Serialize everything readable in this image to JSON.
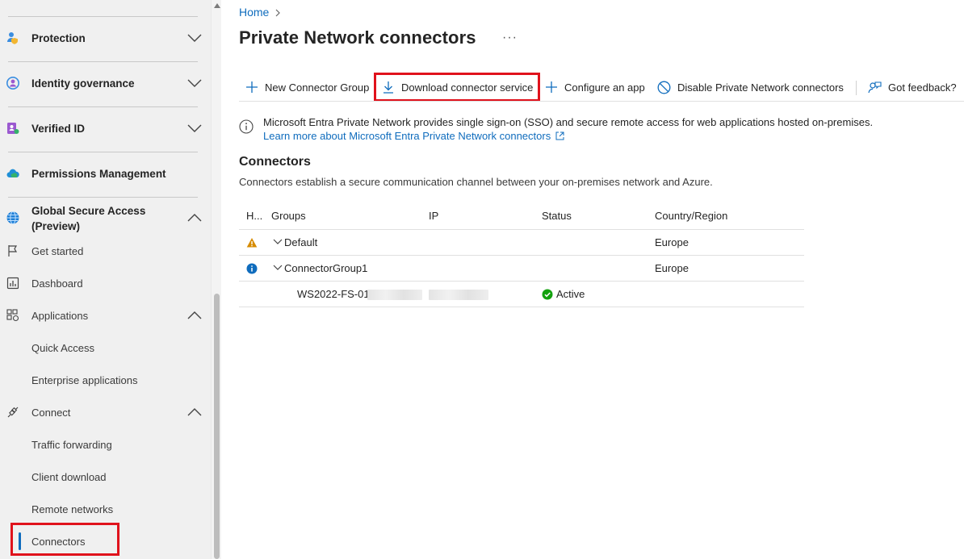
{
  "sidebar": {
    "sections": [
      {
        "label": "Protection",
        "icon": "protection-icon"
      },
      {
        "label": "Identity governance",
        "icon": "identity-governance-icon"
      },
      {
        "label": "Verified ID",
        "icon": "verified-id-icon"
      },
      {
        "label": "Permissions Management",
        "icon": "cloud-icon"
      },
      {
        "label": "Global Secure Access",
        "label2": "(Preview)",
        "icon": "globe-icon"
      }
    ],
    "items": {
      "get_started": "Get started",
      "dashboard": "Dashboard",
      "applications": "Applications",
      "quick_access": "Quick Access",
      "enterprise_applications": "Enterprise applications",
      "connect": "Connect",
      "traffic_forwarding": "Traffic forwarding",
      "client_download": "Client download",
      "remote_networks": "Remote networks",
      "connectors": "Connectors"
    },
    "active_item": "Connectors"
  },
  "breadcrumb": {
    "home": "Home"
  },
  "page": {
    "title": "Private Network connectors",
    "more": "···"
  },
  "toolbar": {
    "new_group": "New Connector Group",
    "download": "Download connector service",
    "configure": "Configure an app",
    "disable": "Disable Private Network connectors",
    "feedback": "Got feedback?"
  },
  "info": {
    "text": "Microsoft Entra Private Network provides single sign-on (SSO) and secure remote access for web applications hosted on-premises.",
    "link": "Learn more about Microsoft Entra Private Network connectors"
  },
  "connectors": {
    "heading": "Connectors",
    "description": "Connectors establish a secure communication channel between your on-premises network and Azure.",
    "columns": {
      "health": "H...",
      "groups": "Groups",
      "ip": "IP",
      "status": "Status",
      "region": "Country/Region"
    },
    "rows": [
      {
        "group": "Default",
        "region": "Europe",
        "health": "warning"
      },
      {
        "group": "ConnectorGroup1",
        "region": "Europe",
        "health": "info"
      },
      {
        "name": "WS2022-FS-01.",
        "status": "Active"
      }
    ]
  },
  "colors": {
    "accent": "#0f6cbd",
    "highlight": "#e0121c",
    "warning": "#d68b00",
    "success": "#13a10e"
  }
}
